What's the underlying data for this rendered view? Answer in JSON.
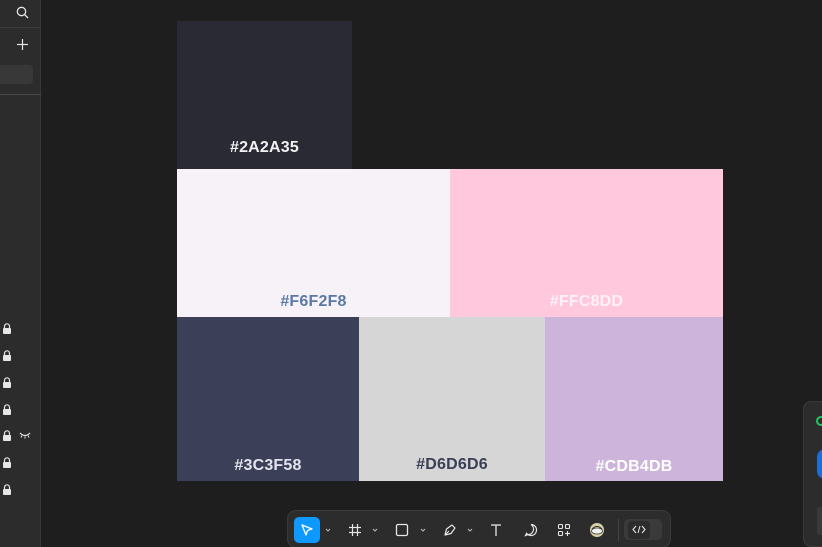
{
  "left_panel": {
    "icons": [
      "search-icon",
      "plus-icon"
    ],
    "lock_rows": 7
  },
  "swatches": [
    {
      "hex": "#2A2A35",
      "label": "#2A2A35"
    },
    {
      "hex": "#F6F2F8",
      "label": "#F6F2F8"
    },
    {
      "hex": "#FFC8DD",
      "label": "#FFC8DD"
    },
    {
      "hex": "#3C3F58",
      "label": "#3C3F58"
    },
    {
      "hex": "#D6D6D6",
      "label": "#D6D6D6"
    },
    {
      "hex": "#CDB4DB",
      "label": "#CDB4DB"
    }
  ],
  "colors": {
    "canvas_bg": "#1e1e1e",
    "panel_bg": "#2c2c2c",
    "accent": "#0d99ff"
  },
  "toolbar": {
    "tools": [
      "move-tool",
      "frame-tool",
      "shape-tool",
      "pen-tool",
      "text-tool",
      "comment-tool",
      "actions-tool",
      "plugin-tool"
    ],
    "active_tool": "move-tool",
    "dev_mode": "code-icon"
  }
}
